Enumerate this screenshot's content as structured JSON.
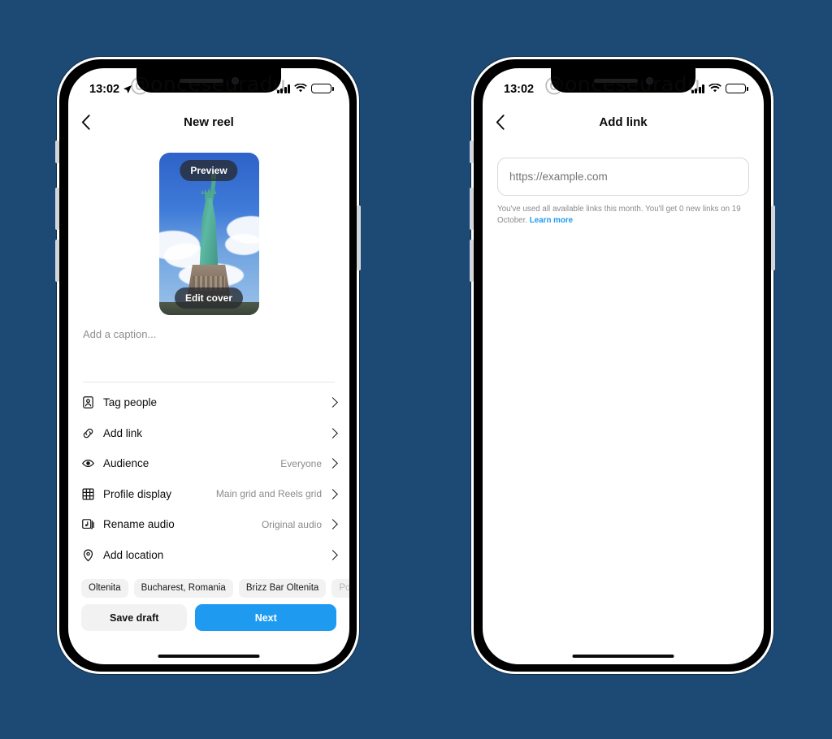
{
  "background_color": "#1d4a74",
  "accent_color": "#1e9af0",
  "watermark": "@onceseuradu",
  "phones": {
    "left": {
      "status_bar": {
        "time": "13:02",
        "location_arrow_icon": "location-arrow-icon",
        "signal_icon": "cellular-signal-icon",
        "wifi_icon": "wifi-icon",
        "battery_icon": "battery-low-power-icon",
        "battery_color": "#f5c518"
      },
      "nav": {
        "back_icon": "chevron-left-icon",
        "title": "New reel"
      },
      "cover": {
        "preview_label": "Preview",
        "edit_cover_label": "Edit cover",
        "image_subject": "statue-of-liberty-photo"
      },
      "caption": {
        "placeholder": "Add a caption..."
      },
      "menu": [
        {
          "icon": "tag-people-icon",
          "label": "Tag people",
          "value": ""
        },
        {
          "icon": "link-icon",
          "label": "Add link",
          "value": ""
        },
        {
          "icon": "audience-eye-icon",
          "label": "Audience",
          "value": "Everyone"
        },
        {
          "icon": "grid-icon",
          "label": "Profile display",
          "value": "Main grid and Reels grid"
        },
        {
          "icon": "audio-card-icon",
          "label": "Rename audio",
          "value": "Original audio"
        },
        {
          "icon": "location-pin-icon",
          "label": "Add location",
          "value": ""
        }
      ],
      "location_chips": [
        {
          "label": "Oltenita",
          "faded": false
        },
        {
          "label": "Bucharest, Romania",
          "faded": false
        },
        {
          "label": "Brizz Bar Oltenita",
          "faded": false
        },
        {
          "label": "Port",
          "faded": true
        }
      ],
      "actions": {
        "save_draft_label": "Save draft",
        "next_label": "Next"
      }
    },
    "right": {
      "status_bar": {
        "time": "13:02",
        "signal_icon": "cellular-signal-icon",
        "wifi_icon": "wifi-icon",
        "battery_icon": "battery-low-power-icon",
        "battery_color": "#f5c518"
      },
      "nav": {
        "back_icon": "chevron-left-icon",
        "title": "Add link"
      },
      "link_field": {
        "placeholder": "https://example.com",
        "value": ""
      },
      "note": {
        "text": "You've used all available links this month. You'll get 0 new links on 19 October. ",
        "link_label": "Learn more"
      }
    }
  }
}
